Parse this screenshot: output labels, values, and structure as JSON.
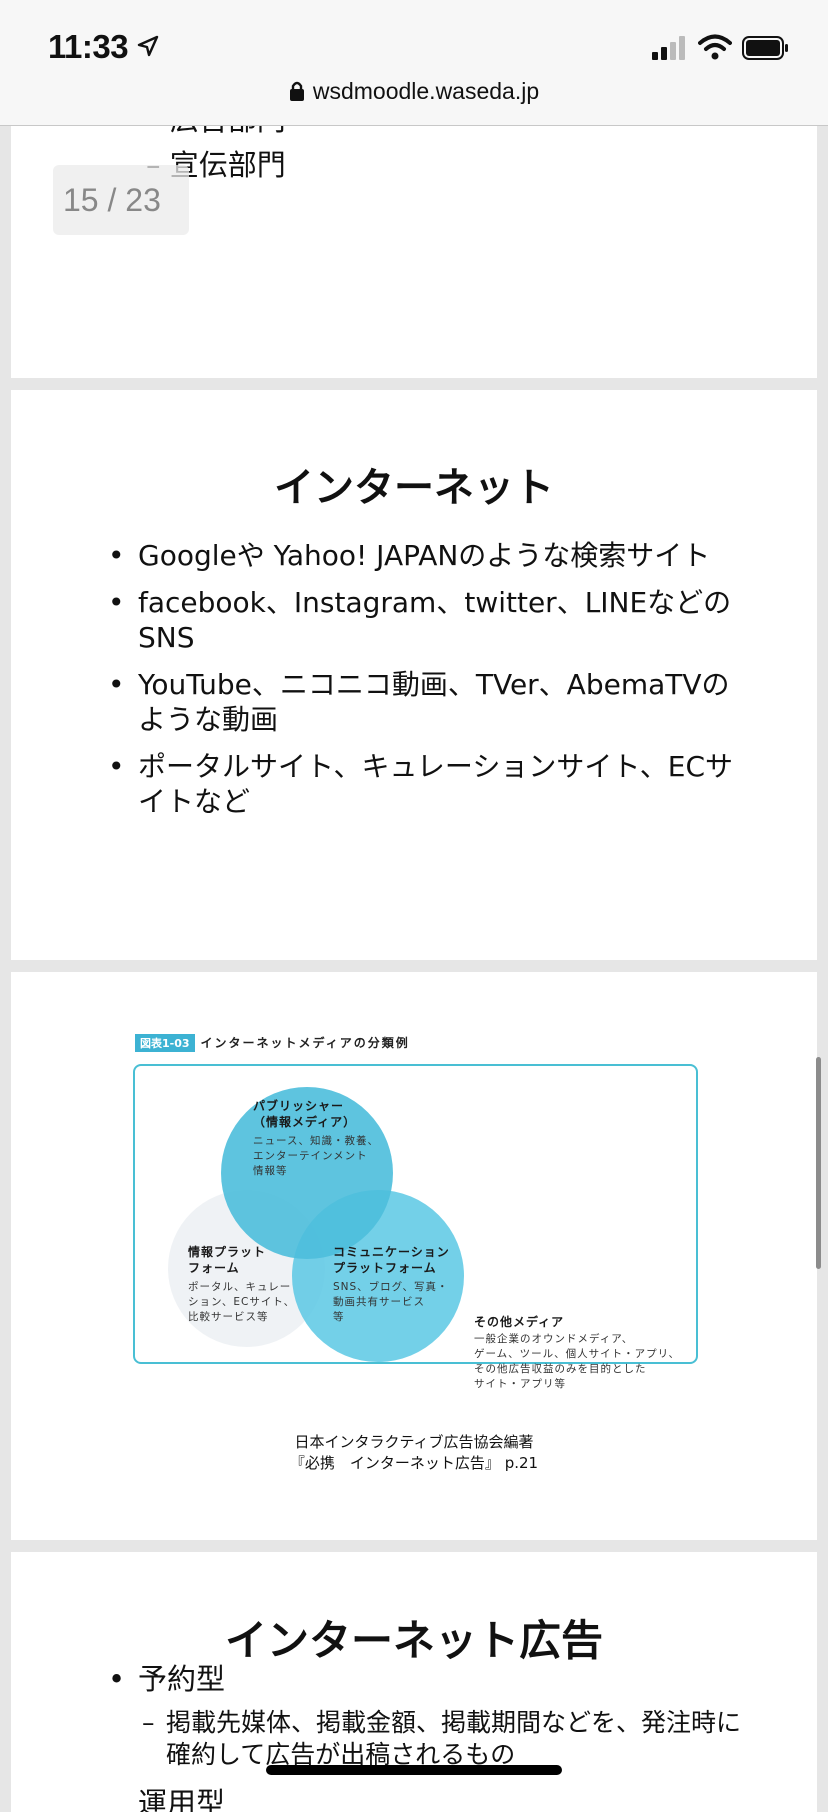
{
  "status_bar": {
    "time": "11:33",
    "icons": [
      "location-arrow-icon",
      "signal-icon",
      "wifi-icon",
      "battery-icon"
    ]
  },
  "browser": {
    "url": "wsdmoodle.waseda.jp",
    "lock_icon": "lock-icon"
  },
  "page_counter": "15 / 23",
  "slides": {
    "prev": {
      "items": [
        "– 広告部門",
        "– 宣伝部門"
      ]
    },
    "internet": {
      "title": "インターネット",
      "bullets": [
        "Googleや Yahoo! JAPANのような検索サイト",
        "facebook、Instagram、twitter、LINEなどのSNS",
        "YouTube、ニコニコ動画、TVer、AbemaTVのような動画",
        "ポータルサイト、キュレーションサイト、ECサイトなど"
      ]
    },
    "figure": {
      "badge": "図表1-03",
      "caption": "インターネットメディアの分類例",
      "publisher_title": "パブリッシャー\n（情報メディア）",
      "publisher_desc": "ニュース、知識・教養、\nエンターテインメント\n情報等",
      "info_title": "情報プラット\nフォーム",
      "info_desc": "ポータル、キュレー\nション、ECサイト、\n比較サービス等",
      "comm_title": "コミュニケーション\nプラットフォーム",
      "comm_desc": "SNS、ブログ、写真・\n動画共有サービス\n等",
      "other_title": "その他メディア",
      "other_desc": "一般企業のオウンドメディア、\nゲーム、ツール、個人サイト・アプリ、\nその他広告収益のみを目的とした\nサイト・アプリ等",
      "source": "日本インタラクティブ広告協会編著\n『必携　インターネット広告』 p.21"
    },
    "internet_ads": {
      "title": "インターネット広告",
      "bullet1": "予約型",
      "sub1": "掲載先媒体、掲載金額、掲載期間などを、発注時に確約して広告が出稿されるもの",
      "bullet2": "運用型"
    }
  },
  "colors": {
    "figure_accent": "#3cb2d3",
    "background": "#e6e6e6"
  }
}
